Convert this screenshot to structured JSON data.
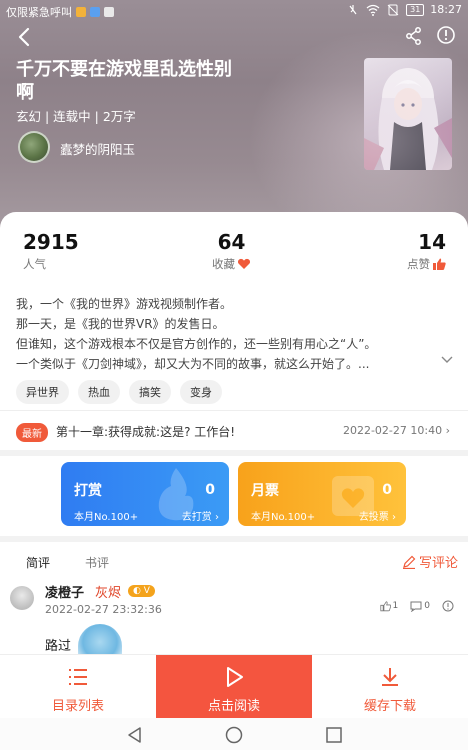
{
  "status_bar": {
    "carrier_text": "仅限紧急呼叫",
    "battery": "31",
    "time": "18:27"
  },
  "book": {
    "title": "千万不要在游戏里乱选性别啊",
    "meta": "玄幻 | 连载中 | 2万字",
    "author": "蠹梦的阴阳玉"
  },
  "stats": {
    "popularity": {
      "value": "2915",
      "label": "人气"
    },
    "collect": {
      "value": "64",
      "label": "收藏"
    },
    "likes": {
      "value": "14",
      "label": "点赞"
    }
  },
  "synopsis": [
    "我，一个《我的世界》游戏视频制作者。",
    "那一天，是《我的世界VR》的发售日。",
    "但谁知，这个游戏根本不仅是官方创作的，还一些别有用心之“人”。",
    "一个类似于《刀剑神域》，却又大为不同的故事，就这么开始了。..."
  ],
  "tags": [
    "异世界",
    "热血",
    "搞笑",
    "变身"
  ],
  "latest": {
    "badge": "最新",
    "title": "第十一章:获得成就:这是? 工作台!",
    "time": "2022-02-27 10:40"
  },
  "support": {
    "reward": {
      "title": "打赏",
      "count": "0",
      "rank": "本月No.100+",
      "action": "去打赏"
    },
    "ticket": {
      "title": "月票",
      "count": "0",
      "rank": "本月No.100+",
      "action": "去投票"
    }
  },
  "comments": {
    "tabs": [
      "简评",
      "书评"
    ],
    "write_label": "写评论",
    "item": {
      "user": "凌橙子",
      "level": "灰烬",
      "badge": "V",
      "time": "2022-02-27 23:32:36",
      "likes": "1",
      "replies": "0",
      "text": "路过"
    }
  },
  "bottom_bar": {
    "toc": "目录列表",
    "read": "点击阅读",
    "cache": "缓存下载"
  },
  "colors": {
    "accent": "#f05a3a",
    "reward_blue": "#2f7cf2",
    "ticket_orange": "#f8a21b"
  }
}
